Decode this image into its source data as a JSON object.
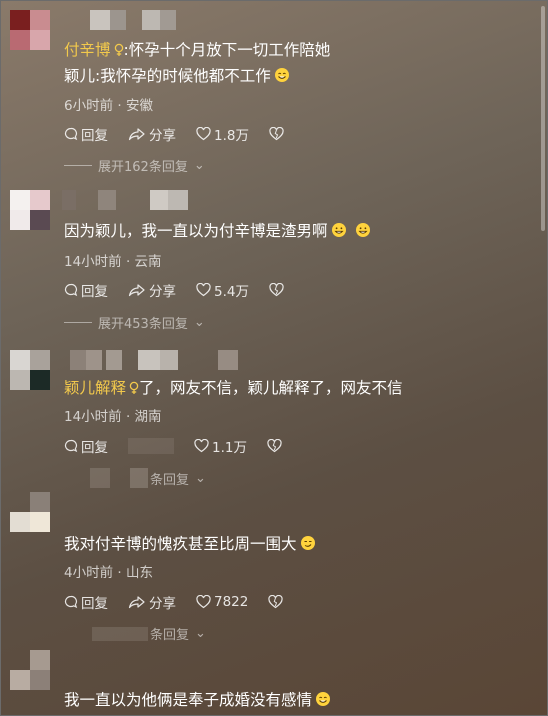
{
  "comments": [
    {
      "user": "付辛博",
      "gender_icon": "female-symbol-icon",
      "line1": ":怀孕十个月放下一切工作陪她",
      "line2": "颖儿:我怀孕的时候他都不工作",
      "meta": "6小时前 · 安徽",
      "reply": "回复",
      "share": "分享",
      "likes": "1.8万",
      "expand": "展开162条回复"
    },
    {
      "text": "因为颖儿，我一直以为付辛博是渣男啊",
      "meta": "14小时前 · 云南",
      "reply": "回复",
      "share": "分享",
      "likes": "5.4万",
      "expand": "展开453条回复"
    },
    {
      "user": "颖儿解释",
      "gender_icon": "female-symbol-icon",
      "text": "了，网友不信，颖儿解释了，网友不信",
      "meta": "14小时前 · 湖南",
      "reply": "回复",
      "likes": "1.1万",
      "expand": "条回复"
    },
    {
      "text": "我对付辛博的愧疚甚至比周一围大",
      "meta": "4小时前 · 山东",
      "reply": "回复",
      "share": "分享",
      "likes": "7822",
      "expand": "条回复"
    },
    {
      "text": "我一直以为他俩是奉子成婚没有感情"
    }
  ],
  "colors": {
    "username": "#f2c94c",
    "text": "#ffffff",
    "meta": "#d8d1c8"
  }
}
